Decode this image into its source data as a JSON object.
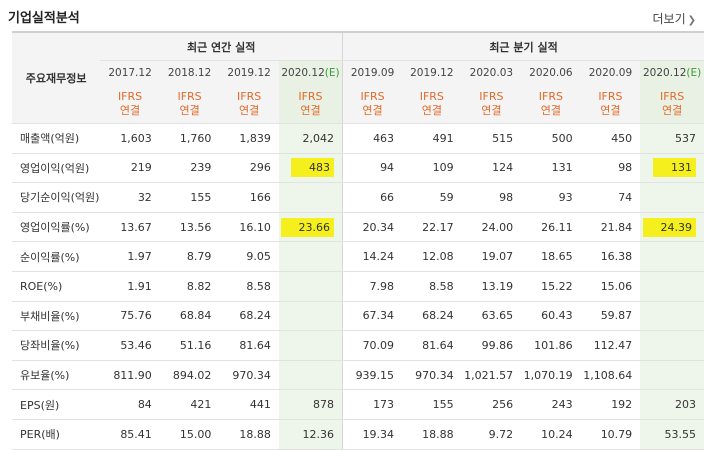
{
  "title": "기업실적분석",
  "more_label": "더보기",
  "header": {
    "row_label": "주요재무정보",
    "annual_group": "최근 연간 실적",
    "quarter_group": "최근 분기 실적",
    "annual_periods": [
      "2017.12",
      "2018.12",
      "2019.12",
      "2020.12"
    ],
    "quarter_periods": [
      "2019.09",
      "2019.12",
      "2020.03",
      "2020.06",
      "2020.09",
      "2020.12"
    ],
    "estimate_mark": "(E)",
    "ifrs": "IFRS",
    "consolidated": "연결"
  },
  "rows": [
    {
      "label": "매출액(억원)",
      "annual": [
        "1,603",
        "1,760",
        "1,839",
        "2,042"
      ],
      "quarter": [
        "463",
        "491",
        "515",
        "500",
        "450",
        "537"
      ]
    },
    {
      "label": "영업이익(억원)",
      "annual": [
        "219",
        "239",
        "296",
        "483"
      ],
      "quarter": [
        "94",
        "109",
        "124",
        "131",
        "98",
        "131"
      ]
    },
    {
      "label": "당기순이익(억원)",
      "annual": [
        "32",
        "155",
        "166",
        ""
      ],
      "quarter": [
        "66",
        "59",
        "98",
        "93",
        "74",
        ""
      ]
    },
    {
      "label": "영업이익률(%)",
      "annual": [
        "13.67",
        "13.56",
        "16.10",
        "23.66"
      ],
      "quarter": [
        "20.34",
        "22.17",
        "24.00",
        "26.11",
        "21.84",
        "24.39"
      ]
    },
    {
      "label": "순이익률(%)",
      "annual": [
        "1.97",
        "8.79",
        "9.05",
        ""
      ],
      "quarter": [
        "14.24",
        "12.08",
        "19.07",
        "18.65",
        "16.38",
        ""
      ]
    },
    {
      "label": "ROE(%)",
      "annual": [
        "1.91",
        "8.82",
        "8.58",
        ""
      ],
      "quarter": [
        "7.98",
        "8.58",
        "13.19",
        "15.22",
        "15.06",
        ""
      ]
    },
    {
      "label": "부채비율(%)",
      "annual": [
        "75.76",
        "68.84",
        "68.24",
        ""
      ],
      "quarter": [
        "67.34",
        "68.24",
        "63.65",
        "60.43",
        "59.87",
        ""
      ]
    },
    {
      "label": "당좌비율(%)",
      "annual": [
        "53.46",
        "51.16",
        "81.64",
        ""
      ],
      "quarter": [
        "70.09",
        "81.64",
        "99.86",
        "101.86",
        "112.47",
        ""
      ]
    },
    {
      "label": "유보율(%)",
      "annual": [
        "811.90",
        "894.02",
        "970.34",
        ""
      ],
      "quarter": [
        "939.15",
        "970.34",
        "1,021.57",
        "1,070.19",
        "1,108.64",
        ""
      ]
    },
    {
      "label": "EPS(원)",
      "annual": [
        "84",
        "421",
        "441",
        "878"
      ],
      "quarter": [
        "173",
        "155",
        "256",
        "243",
        "192",
        "203"
      ]
    },
    {
      "label": "PER(배)",
      "annual": [
        "85.41",
        "15.00",
        "18.88",
        "12.36"
      ],
      "quarter": [
        "19.34",
        "18.88",
        "9.72",
        "10.24",
        "10.79",
        "53.55"
      ]
    }
  ],
  "highlights": {
    "colors": {
      "highlight": "#f5ef1e",
      "estimate_bg": "#eef5ea",
      "ifrs_text": "#e06a2a"
    }
  }
}
